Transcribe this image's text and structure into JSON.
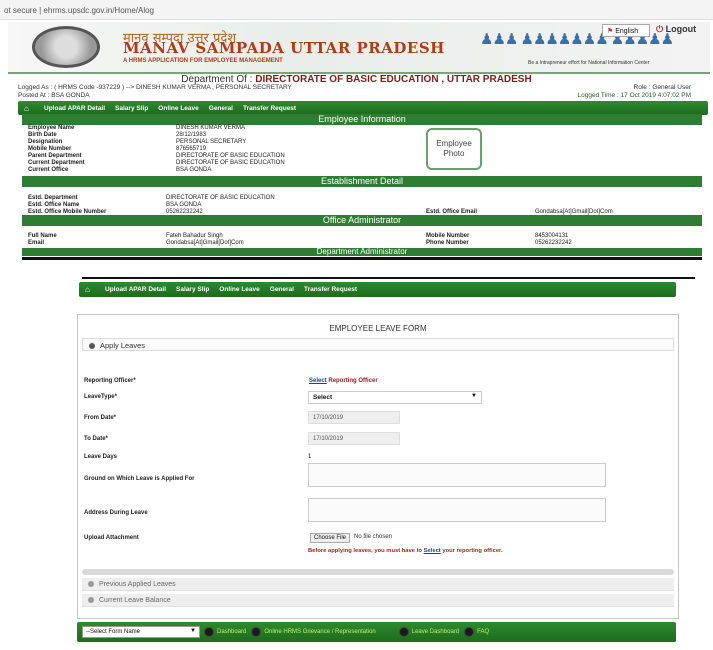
{
  "browser": {
    "url": "ot secure | ehrms.upsdc.gov.in/Home/Alog"
  },
  "header": {
    "title_hindi": "मानव सम्पदा उत्तर प्रदेश",
    "title": "MANAV SAMPADA UTTAR PRADESH",
    "subtitle": "A HRMS APPLICATION FOR EMPLOYEE MANAGEMENT",
    "people_glyphs": "♟♟♟ ♟♟♟♟♟♟♟ ♟♟♟♟♟",
    "people_caption": "Be a Intrapreneur effort for National Information Center",
    "lang_label": "English",
    "logout_label": "Logout"
  },
  "session": {
    "dept_prefix": "Department Of :",
    "dept_name": "DIRECTORATE OF BASIC EDUCATION , UTTAR PRADESH",
    "logged_as": "Logged As : ( HRMS Code -937229 ) --> DINESH KUMAR VERMA , PERSONAL SECRETARY",
    "posted_at": "Posted At : BSA GONDA",
    "role": "Role : General User",
    "logged_time": "Logged Time : 17 Oct 2019 4:07:02 PM"
  },
  "nav": {
    "items": [
      "Upload APAR Detail",
      "Salary Slip",
      "Online Leave",
      "General",
      "Transfer Request"
    ]
  },
  "employee_info": {
    "heading": "Employee Information",
    "rows": [
      {
        "label": "Employee Name",
        "value": "DINESH KUMAR VERMA"
      },
      {
        "label": "Birth Date",
        "value": "28/12/1983"
      },
      {
        "label": "Designation",
        "value": "PERSONAL SECRETARY"
      },
      {
        "label": "Mobile Number",
        "value": "876565719"
      },
      {
        "label": "Parent Department",
        "value": "DIRECTORATE OF BASIC EDUCATION"
      },
      {
        "label": "Current Department",
        "value": "DIRECTORATE OF BASIC EDUCATION"
      },
      {
        "label": "Current Office",
        "value": "BSA GONDA"
      }
    ],
    "photo_label": "Employee Photo"
  },
  "establishment": {
    "heading": "Establishment Detail",
    "dept_label": "Estd. Department",
    "dept_value": "DIRECTORATE OF BASIC EDUCATION",
    "office_label": "Estd. Office Name",
    "office_value": "BSA GONDA",
    "mobile_label": "Estd. Office Mobile Number",
    "mobile_value": "05262232242",
    "email_label": "Estd. Office Email",
    "email_value": "Gondabsa[At]Gmail[Dot]Com"
  },
  "office_admin": {
    "heading": "Office Administrator",
    "name_label": "Full Name",
    "name_value": "Fateh Bahadur Singh",
    "email_label": "Email",
    "email_value": "Gondabsa[At]Gmail[Dot]Com",
    "mobile_label": "Mobile Number",
    "mobile_value": "8453004131",
    "phone_label": "Phone Number",
    "phone_value": "05262232242"
  },
  "dept_admin": {
    "heading": "Department Administrator"
  },
  "leave_form": {
    "title": "EMPLOYEE LEAVE FORM",
    "apply_heading": "Apply Leaves",
    "reporting_officer_label": "Reporting Officer*",
    "reporting_officer_link": "Select",
    "reporting_officer_text": " Reporting Officer",
    "leave_type_label": "LeaveType*",
    "leave_type_value": "Select",
    "from_date_label": "From Date*",
    "from_date_value": "17/10/2019",
    "to_date_label": "To Date*",
    "to_date_value": "17/10/2019",
    "leave_days_label": "Leave Days",
    "leave_days_value": "1",
    "ground_label": "Ground on Which Leave is Applied For",
    "address_label": "Address During Leave",
    "attachment_label": "Upload Attachment",
    "choose_file_label": "Choose File",
    "no_file_text": "No file chosen",
    "warning_pre": "Before applying leaves, you must have to ",
    "warning_link": "Select",
    "warning_post": " your reporting officer.",
    "previous_heading": "Previous Applied Leaves",
    "balance_heading": "Current Leave Balance"
  },
  "bottom_bar": {
    "select_value": "--Select Form Name",
    "items": [
      "Dashboard",
      "Online HRMS Grievance / Representation",
      "Leave Dashboard",
      "FAQ"
    ]
  }
}
